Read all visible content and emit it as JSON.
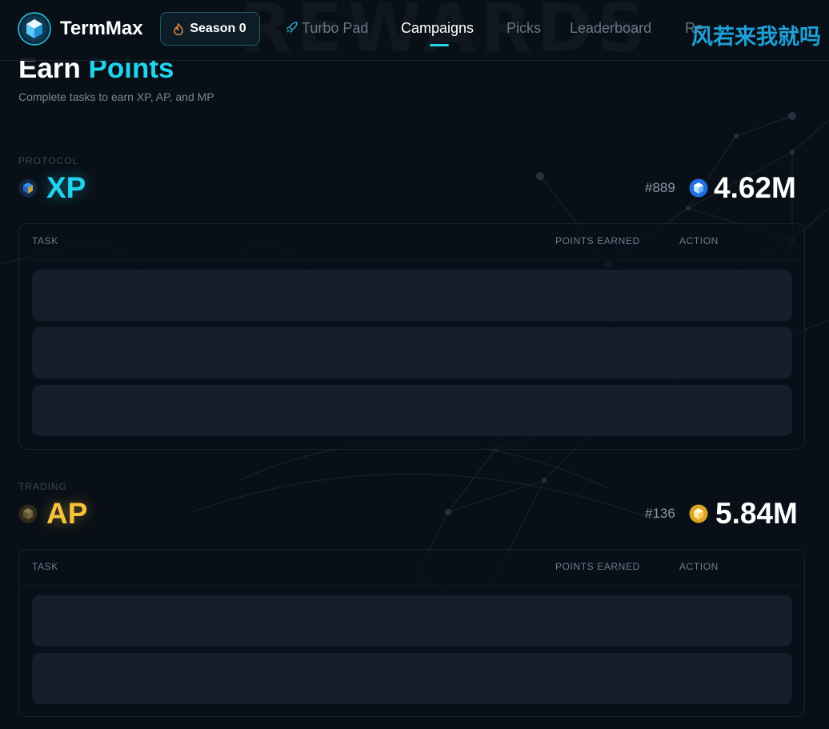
{
  "header": {
    "watermark": "REWARDS",
    "brand": "TermMax",
    "season_button": "Season 0",
    "nav_items": [
      {
        "label": "Turbo Pad",
        "icon": "rocket-icon"
      },
      {
        "label": "Campaigns",
        "active": true
      },
      {
        "label": "Picks"
      },
      {
        "label": "Leaderboard"
      },
      {
        "label": "Re"
      }
    ],
    "overlay_text": "风若来我就吗"
  },
  "page": {
    "title_main": "Earn",
    "title_accent": "Points",
    "subtitle": "Complete tasks to earn XP, AP, and MP"
  },
  "sections": [
    {
      "label": "PROTOCOL",
      "name": "XP",
      "rank": "#889",
      "score": "4.62M",
      "color": "#22d3ee",
      "columns": [
        "TASK",
        "POINTS EARNED",
        "ACTION"
      ],
      "placeholder_rows": 3
    },
    {
      "label": "TRADING",
      "name": "AP",
      "rank": "#136",
      "score": "5.84M",
      "color": "#f7c23d",
      "columns": [
        "TASK",
        "POINTS EARNED",
        "ACTION"
      ],
      "placeholder_rows": 2
    }
  ],
  "colors": {
    "background": "#090f17",
    "accent": "#22d3ee",
    "gold": "#f7c23d",
    "row_placeholder": "#151e2c"
  }
}
